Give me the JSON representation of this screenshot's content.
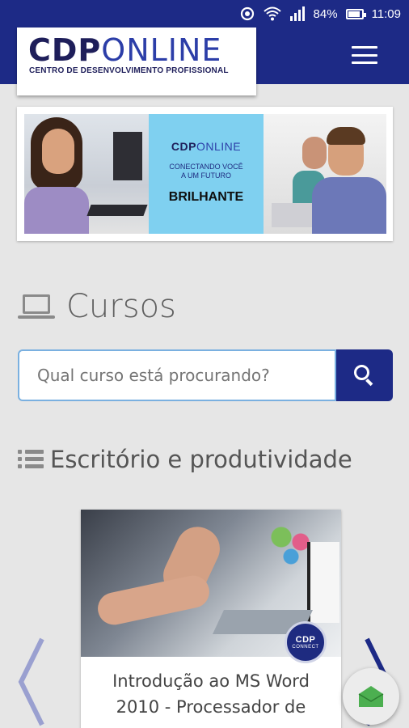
{
  "status_bar": {
    "battery": "84%",
    "time": "11:09",
    "icons": [
      "sync-icon",
      "wifi-icon",
      "signal-icon",
      "battery-icon"
    ]
  },
  "header": {
    "logo_cdp": "CDP",
    "logo_online": "ONLINE",
    "logo_subtitle": "CENTRO DE DESENVOLVIMENTO PROFISSIONAL",
    "menu_icon": "hamburger-menu-icon"
  },
  "banner": {
    "logo_cdp": "CDP",
    "logo_online": "ONLINE",
    "line1": "CONECTANDO VOCÊ",
    "line2": "A UM FUTURO",
    "highlight": "BRILHANTE"
  },
  "section": {
    "title": "Cursos",
    "icon": "laptop-icon"
  },
  "search": {
    "placeholder": "Qual curso está procurando?",
    "button_icon": "search-icon"
  },
  "category": {
    "title": "Escritório e produtividade",
    "icon": "list-icon"
  },
  "course_card": {
    "badge_top": "CDP",
    "badge_bottom": "CONNECT",
    "title": "Introdução ao MS Word 2010 - Processador de"
  },
  "colors": {
    "brand_blue": "#1d2a86",
    "background": "#e6e6e6",
    "banner_cyan": "#7fd0f0",
    "fab_green": "#4caf50"
  }
}
